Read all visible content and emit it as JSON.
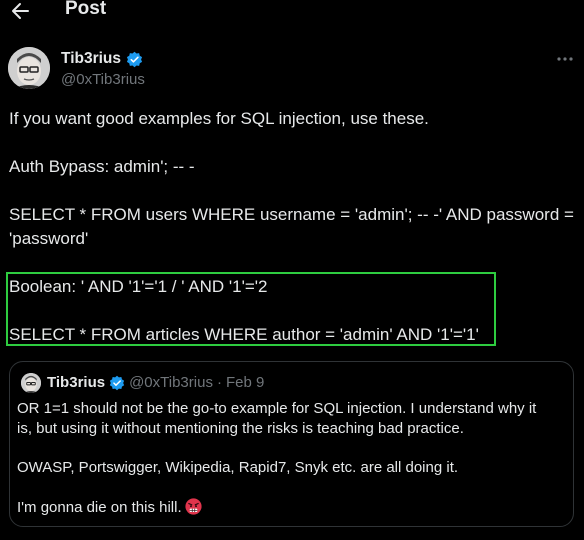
{
  "header": {
    "title": "Post"
  },
  "author": {
    "name": "Tib3rius",
    "handle": "@0xTib3rius"
  },
  "post": {
    "lines": [
      "If you want good examples for SQL injection, use these.",
      "Auth Bypass: admin'; -- -",
      "SELECT * FROM users WHERE username = 'admin'; -- -' AND password =",
      "'password'",
      "Boolean: ' AND '1'='1 / ' AND '1'='2",
      "SELECT * FROM articles WHERE author = 'admin' AND '1'='1'"
    ]
  },
  "quote": {
    "name": "Tib3rius",
    "handle": "@0xTib3rius",
    "separator": "·",
    "date": "Feb 9",
    "lines": [
      "OR 1=1 should not be the go-to example for SQL injection. I understand why it",
      "is, but using it without mentioning the risks is teaching bad practice.",
      "OWASP, Portswigger, Wikipedia, Rapid7, Snyk etc. are all doing it.",
      "I'm gonna die on this hill."
    ],
    "emoji": "angry-face-emoji"
  },
  "colors": {
    "background": "#000000",
    "text": "#e7e9ea",
    "muted": "#71767b",
    "verified": "#1d9bf0",
    "highlight": "#2ecc40",
    "border": "#2f3336"
  },
  "icons": {
    "back": "arrow-left-icon",
    "verified": "verified-badge-icon",
    "more": "more-horizontal-icon"
  }
}
